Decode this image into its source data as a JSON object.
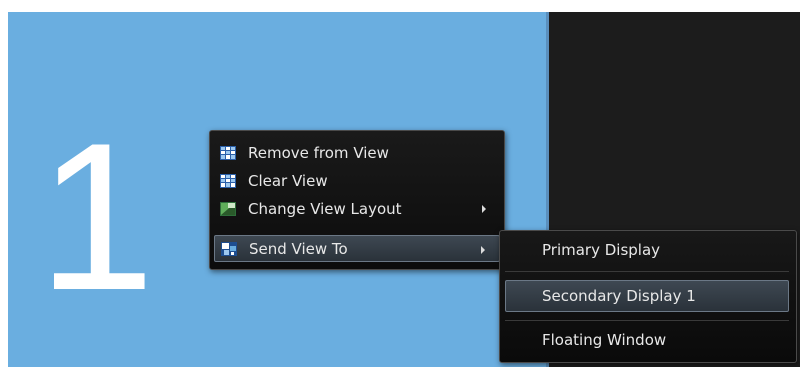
{
  "view": {
    "number": "1"
  },
  "context_menu": {
    "items": [
      {
        "label": "Remove from View",
        "icon": "remove-from-view-icon"
      },
      {
        "label": "Clear View",
        "icon": "clear-view-icon"
      },
      {
        "label": "Change View Layout",
        "icon": "change-layout-icon",
        "has_submenu": true
      },
      {
        "label": "Send View To",
        "icon": "send-view-icon",
        "has_submenu": true,
        "active": true
      }
    ]
  },
  "submenu": {
    "items": [
      {
        "label": "Primary Display"
      },
      {
        "label": "Secondary Display 1",
        "active": true
      },
      {
        "label": "Floating Window"
      }
    ]
  },
  "colors": {
    "view_background": "#6aaee0",
    "dark_pane": "#1c1c1c",
    "menu_background": "#121212",
    "highlight": "#3a444e"
  }
}
